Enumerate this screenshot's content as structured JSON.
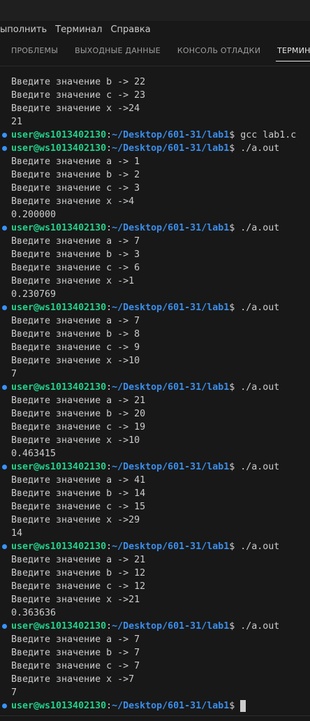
{
  "menu": [
    "ыполнить",
    "Терминал",
    "Справка"
  ],
  "tabs": [
    "ПРОБЛЕМЫ",
    "ВЫХОДНЫЕ ДАННЫЕ",
    "КОНСОЛЬ ОТЛАДКИ",
    "ТЕРМИНАЛ"
  ],
  "active_tab": "ТЕРМИНАЛ",
  "prompt": {
    "user": "user@ws1013402130",
    "colon": ":",
    "path": "~/Desktop/601-31/lab1",
    "symbol": "$"
  },
  "lines": [
    {
      "type": "out",
      "text": "Введите значение b -> 22"
    },
    {
      "type": "out",
      "text": "Введите значение c -> 23"
    },
    {
      "type": "out",
      "text": "Введите значение x ->24"
    },
    {
      "type": "out",
      "text": "21"
    },
    {
      "type": "prompt",
      "cmd": " gcc lab1.c"
    },
    {
      "type": "prompt",
      "cmd": " ./a.out"
    },
    {
      "type": "out",
      "text": "Введите значение a -> 1"
    },
    {
      "type": "out",
      "text": "Введите значение b -> 2"
    },
    {
      "type": "out",
      "text": "Введите значение c -> 3"
    },
    {
      "type": "out",
      "text": "Введите значение x ->4"
    },
    {
      "type": "out",
      "text": "0.200000"
    },
    {
      "type": "prompt",
      "cmd": " ./a.out"
    },
    {
      "type": "out",
      "text": "Введите значение a -> 7"
    },
    {
      "type": "out",
      "text": "Введите значение b -> 3"
    },
    {
      "type": "out",
      "text": "Введите значение c -> 6"
    },
    {
      "type": "out",
      "text": "Введите значение x ->1"
    },
    {
      "type": "out",
      "text": "0.230769"
    },
    {
      "type": "prompt",
      "cmd": " ./a.out"
    },
    {
      "type": "out",
      "text": "Введите значение a -> 7"
    },
    {
      "type": "out",
      "text": "Введите значение b -> 8"
    },
    {
      "type": "out",
      "text": "Введите значение c -> 9"
    },
    {
      "type": "out",
      "text": "Введите значение x ->10"
    },
    {
      "type": "out",
      "text": "7"
    },
    {
      "type": "prompt",
      "cmd": " ./a.out"
    },
    {
      "type": "out",
      "text": "Введите значение a -> 21"
    },
    {
      "type": "out",
      "text": "Введите значение b -> 20"
    },
    {
      "type": "out",
      "text": "Введите значение c -> 19"
    },
    {
      "type": "out",
      "text": "Введите значение x ->10"
    },
    {
      "type": "out",
      "text": "0.463415"
    },
    {
      "type": "prompt",
      "cmd": " ./a.out"
    },
    {
      "type": "out",
      "text": "Введите значение a -> 41"
    },
    {
      "type": "out",
      "text": "Введите значение b -> 14"
    },
    {
      "type": "out",
      "text": "Введите значение c -> 15"
    },
    {
      "type": "out",
      "text": "Введите значение x ->29"
    },
    {
      "type": "out",
      "text": "14"
    },
    {
      "type": "prompt",
      "cmd": " ./a.out"
    },
    {
      "type": "out",
      "text": "Введите значение a -> 21"
    },
    {
      "type": "out",
      "text": "Введите значение b -> 12"
    },
    {
      "type": "out",
      "text": "Введите значение c -> 12"
    },
    {
      "type": "out",
      "text": "Введите значение x ->21"
    },
    {
      "type": "out",
      "text": "0.363636"
    },
    {
      "type": "prompt",
      "cmd": " ./a.out"
    },
    {
      "type": "out",
      "text": "Введите значение a -> 7"
    },
    {
      "type": "out",
      "text": "Введите значение b -> 7"
    },
    {
      "type": "out",
      "text": "Введите значение c -> 7"
    },
    {
      "type": "out",
      "text": "Введите значение x ->7"
    },
    {
      "type": "out",
      "text": "7"
    },
    {
      "type": "prompt",
      "cmd": " ",
      "cursor": true
    }
  ],
  "colors": {
    "background": "#181818",
    "user": "#23d18b",
    "path": "#3b8eea",
    "marker": "#3794ff",
    "text": "#cccccc"
  }
}
